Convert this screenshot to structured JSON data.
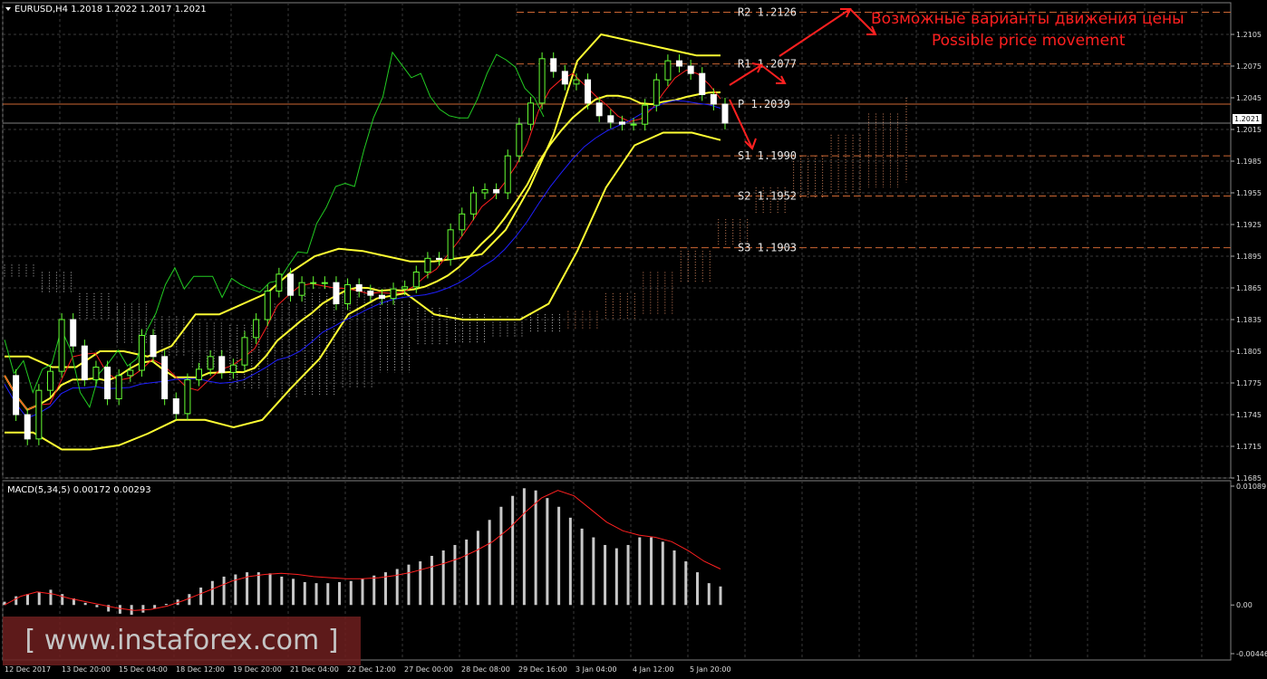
{
  "symbol_header": "EURUSD,H4  1.2018 1.2022 1.2017 1.2021",
  "macd_header": "MACD(5,34,5) 0.00172 0.00293",
  "current_price_label": "1.2021",
  "annotations": {
    "ru": "Возможные варианты движения цены",
    "en": "Possible price movement"
  },
  "watermark": "[ www.instaforex.com ]",
  "colors": {
    "background": "#000000",
    "grid": "#3a3a3a",
    "candle": "#66ff33",
    "bollinger": "#ffff33",
    "kijun": "#1f1fff",
    "tenkan": "#ff2020",
    "chikou": "#22cc22",
    "cloud": "#e8e8e8",
    "cloud_bear": "#ffa070",
    "pivot_lines": "#cc6633",
    "arrows": "#ff2020",
    "annotation_text": "#ff2020",
    "macd_bars": "#c8c8c8",
    "macd_signal": "#ff2020"
  },
  "chart_data": [
    {
      "type": "candlestick",
      "symbol": "EURUSD",
      "timeframe": "H4",
      "ohlc_header": [
        1.2018,
        1.2022,
        1.2017,
        1.2021
      ],
      "ylim": [
        1.1685,
        1.2135
      ],
      "y_ticks": [
        "1.2105",
        "1.2075",
        "1.2045",
        "1.2015",
        "1.1985",
        "1.1955",
        "1.1925",
        "1.1895",
        "1.1865",
        "1.1835",
        "1.1805",
        "1.1775",
        "1.1745",
        "1.1715",
        "1.1685"
      ],
      "x_ticks": [
        "12 Dec 2017",
        "13 Dec 20:00",
        "15 Dec 04:00",
        "18 Dec 12:00",
        "19 Dec 20:00",
        "21 Dec 04:00",
        "22 Dec 12:00",
        "27 Dec 00:00",
        "28 Dec 08:00",
        "29 Dec 16:00",
        "3 Jan 04:00",
        "4 Jan 12:00",
        "5 Jan 20:00"
      ],
      "pivot_levels": [
        {
          "label": "R2  1.2126",
          "value": 1.2126
        },
        {
          "label": "R1  1.2077",
          "value": 1.2077
        },
        {
          "label": "P  1.2039",
          "value": 1.2039
        },
        {
          "label": "S1  1.1990",
          "value": 1.199
        },
        {
          "label": "S2  1.1952",
          "value": 1.1952
        },
        {
          "label": "S3  1.1903",
          "value": 1.1903
        }
      ],
      "current_price": 1.2021,
      "close_path": [
        1.1782,
        1.1745,
        1.1722,
        1.1768,
        1.1786,
        1.1835,
        1.181,
        1.1778,
        1.179,
        1.176,
        1.1782,
        1.1787,
        1.182,
        1.18,
        1.176,
        1.1746,
        1.1778,
        1.1788,
        1.18,
        1.1785,
        1.1792,
        1.1818,
        1.1835,
        1.1862,
        1.1878,
        1.1858,
        1.187,
        1.187,
        1.187,
        1.185,
        1.1868,
        1.1862,
        1.1858,
        1.1855,
        1.1864,
        1.1866,
        1.188,
        1.1893,
        1.1892,
        1.192,
        1.1935,
        1.1955,
        1.1958,
        1.1955,
        1.199,
        1.202,
        1.204,
        1.2082,
        1.207,
        1.2058,
        1.2062,
        1.204,
        1.2028,
        1.2022,
        1.202,
        1.202,
        1.2038,
        1.2062,
        1.208,
        1.2075,
        1.2068,
        1.2048,
        1.2039,
        1.2021
      ],
      "bollinger_upper_path": [
        1.18,
        1.18,
        1.179,
        1.179,
        1.1805,
        1.1805,
        1.18,
        1.181,
        1.184,
        1.184,
        1.185,
        1.186,
        1.188,
        1.1895,
        1.1902,
        1.19,
        1.1895,
        1.189,
        1.189,
        1.1893,
        1.1897,
        1.192,
        1.196,
        1.201,
        1.208,
        1.2105,
        1.21,
        1.2095,
        1.209,
        1.2085,
        1.2085
      ],
      "bollinger_lower_path": [
        1.1728,
        1.1728,
        1.1712,
        1.1712,
        1.1716,
        1.1727,
        1.174,
        1.174,
        1.1733,
        1.174,
        1.177,
        1.1798,
        1.184,
        1.1855,
        1.186,
        1.184,
        1.1835,
        1.1835,
        1.1835,
        1.185,
        1.19,
        1.196,
        1.2,
        1.2012,
        1.2012,
        1.2005
      ],
      "macd": {
        "header_values": [
          0.00172,
          0.00293
        ],
        "ylim": [
          -0.00446,
          0.01089
        ],
        "y_ticks": [
          "0.01089",
          "0.00",
          "-0.00446"
        ],
        "histogram_path": [
          0.0003,
          0.0008,
          0.001,
          0.0012,
          0.0014,
          0.001,
          0.0006,
          0.0002,
          -0.0002,
          -0.0006,
          -0.0008,
          -0.0009,
          -0.0007,
          -0.0003,
          0.0001,
          0.0005,
          0.001,
          0.0016,
          0.0022,
          0.0026,
          0.0028,
          0.003,
          0.003,
          0.0029,
          0.0026,
          0.0024,
          0.0021,
          0.002,
          0.002,
          0.0021,
          0.0022,
          0.0024,
          0.0027,
          0.003,
          0.0033,
          0.0037,
          0.004,
          0.0045,
          0.005,
          0.0055,
          0.006,
          0.0068,
          0.0078,
          0.009,
          0.01,
          0.0107,
          0.0105,
          0.0098,
          0.009,
          0.008,
          0.007,
          0.0062,
          0.0055,
          0.0052,
          0.0055,
          0.0062,
          0.0062,
          0.0058,
          0.005,
          0.004,
          0.003,
          0.002,
          0.0017
        ],
        "signal_path": [
          0.0,
          0.0008,
          0.0012,
          0.001,
          0.0006,
          0.0003,
          0.0,
          -0.0003,
          -0.0005,
          -0.0004,
          -0.0001,
          0.0004,
          0.001,
          0.0016,
          0.0022,
          0.0026,
          0.0028,
          0.0029,
          0.0028,
          0.0026,
          0.0025,
          0.0024,
          0.0024,
          0.0025,
          0.0027,
          0.003,
          0.0034,
          0.0038,
          0.0043,
          0.005,
          0.0058,
          0.007,
          0.0085,
          0.0098,
          0.0105,
          0.01,
          0.0088,
          0.0076,
          0.0068,
          0.0064,
          0.0062,
          0.0058,
          0.005,
          0.004,
          0.0033
        ]
      }
    }
  ]
}
